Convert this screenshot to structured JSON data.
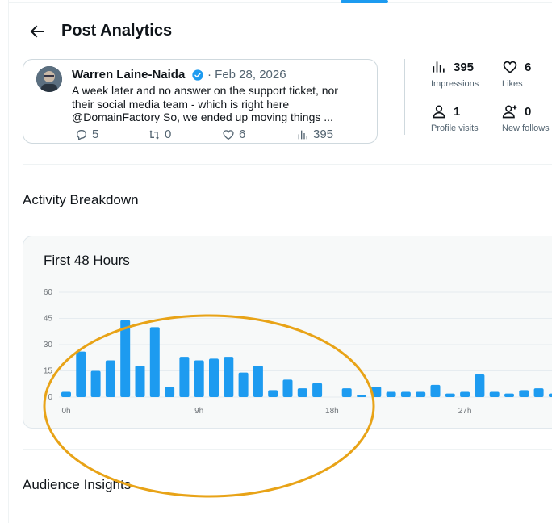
{
  "header": {
    "title": "Post Analytics",
    "back_icon": "arrow-left-icon"
  },
  "post": {
    "author": "Warren Laine-Naida",
    "date": "· Feb 28, 2026",
    "text_lines": [
      "A week later and no answer on the support ticket, nor",
      "their social media team - which is right here",
      "@DomainFactory  So, we ended up moving things ..."
    ],
    "replies": "5",
    "reposts": "0",
    "likes": "6",
    "views": "395"
  },
  "metrics": {
    "impressions": {
      "value": "395",
      "label": "Impressions",
      "icon": "bar-chart-icon"
    },
    "likes": {
      "value": "6",
      "label": "Likes",
      "icon": "heart-icon"
    },
    "profile_visits": {
      "value": "1",
      "label": "Profile visits",
      "icon": "person-icon"
    },
    "new_follows": {
      "value": "0",
      "label": "New follows",
      "icon": "person-add-icon"
    }
  },
  "sections": {
    "activity": "Activity Breakdown",
    "audience": "Audience Insights"
  },
  "chart_data": {
    "type": "bar",
    "title": "First 48 Hours",
    "xlabel": "",
    "ylabel": "",
    "ylim": [
      0,
      60
    ],
    "yticks": [
      0,
      15,
      30,
      45,
      60
    ],
    "x_tick_labels": [
      "0h",
      "9h",
      "18h",
      "27h"
    ],
    "x_tick_hours": [
      0,
      9,
      18,
      27
    ],
    "grid": true,
    "categories": [
      0,
      1,
      2,
      3,
      4,
      5,
      6,
      7,
      8,
      9,
      10,
      11,
      12,
      13,
      14,
      15,
      16,
      17,
      18,
      19,
      20,
      21,
      22,
      23,
      24,
      25,
      26,
      27,
      28,
      29,
      30,
      31,
      32,
      33,
      34
    ],
    "values": [
      3,
      26,
      15,
      21,
      44,
      18,
      40,
      6,
      23,
      21,
      22,
      23,
      14,
      18,
      4,
      10,
      5,
      8,
      0,
      5,
      1,
      6,
      3,
      3,
      3,
      7,
      2,
      3,
      13,
      3,
      2,
      4,
      5,
      2,
      0
    ],
    "color": "#1d9bf0"
  },
  "annotation": {
    "color": "#e8a317"
  },
  "colors": {
    "accent": "#1d9bf0",
    "muted": "#536471"
  }
}
